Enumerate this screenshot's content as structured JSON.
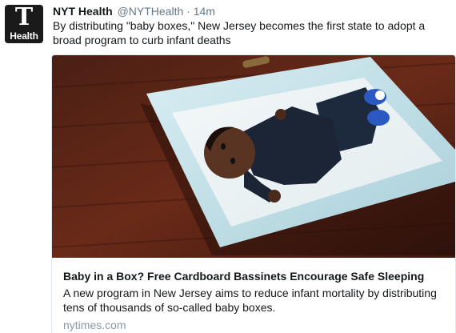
{
  "tweet": {
    "avatar_glyph": "T",
    "avatar_label": "Health",
    "display_name": "NYT Health",
    "handle": "@NYTHealth",
    "separator": "·",
    "time": "14m",
    "text": "By distributing \"baby boxes,\" New Jersey becomes the first state to adopt a broad program to curb infant deaths"
  },
  "card": {
    "image_icon": "baby-in-box-photo",
    "title": "Baby in a Box? Free Cardboard Bassinets Encourage Safe Sleeping",
    "description": "A new program in New Jersey aims to reduce infant mortality by distributing tens of thousands of so-called baby boxes.",
    "domain": "nytimes.com"
  },
  "colors": {
    "text": "#14171a",
    "secondary": "#657786",
    "domain": "#8899a6",
    "border": "#e1e8ed"
  }
}
